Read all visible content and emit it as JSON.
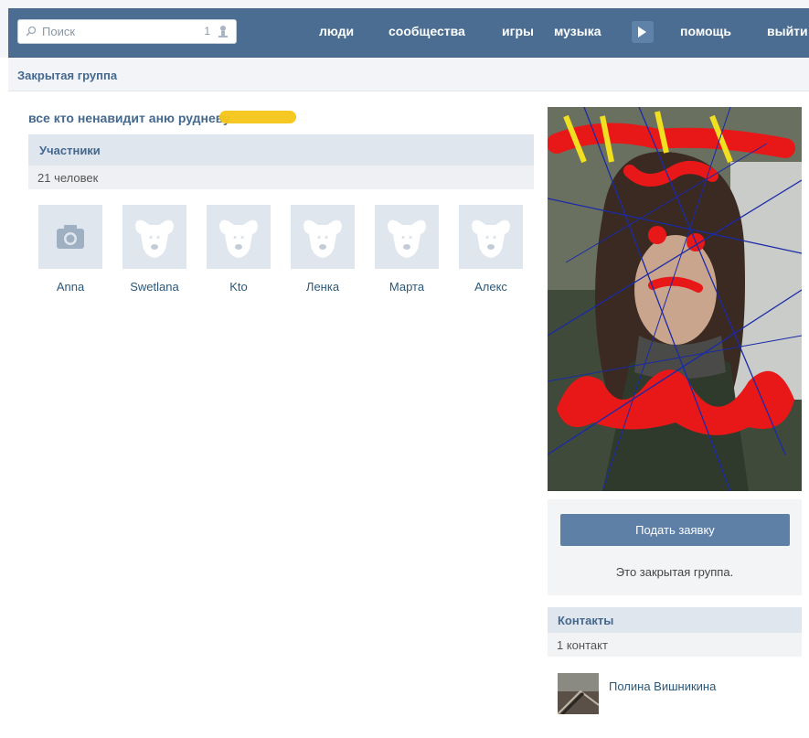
{
  "header": {
    "search": {
      "placeholder": "Поиск",
      "count": "1"
    },
    "nav": [
      "люди",
      "сообщества",
      "игры",
      "музыка",
      "помощь",
      "выйти"
    ]
  },
  "subbar": {
    "title": "Закрытая группа"
  },
  "group": {
    "name": "все кто ненавидит аню рудневу"
  },
  "members": {
    "title": "Участники",
    "count": "21 человек",
    "list": [
      {
        "name": "Anna",
        "avatar": "camera-icon"
      },
      {
        "name": "Swetlana",
        "avatar": "deactivated-dog-icon"
      },
      {
        "name": "Kto",
        "avatar": "deactivated-dog-icon"
      },
      {
        "name": "Ленка",
        "avatar": "deactivated-dog-icon"
      },
      {
        "name": "Марта",
        "avatar": "deactivated-dog-icon"
      },
      {
        "name": "Алекс",
        "avatar": "deactivated-dog-icon"
      }
    ]
  },
  "sidebar": {
    "apply_label": "Подать заявку",
    "closed_text": "Это закрытая группа.",
    "contacts_title": "Контакты",
    "contacts_count": "1 контакт",
    "contacts": [
      {
        "name": "Полина Вишникина"
      }
    ]
  },
  "colors": {
    "topbar": "#4a6d91",
    "link": "#2b587a",
    "accent": "#45688e",
    "button": "#5e80a7",
    "section_bg": "#dfe6ee"
  }
}
